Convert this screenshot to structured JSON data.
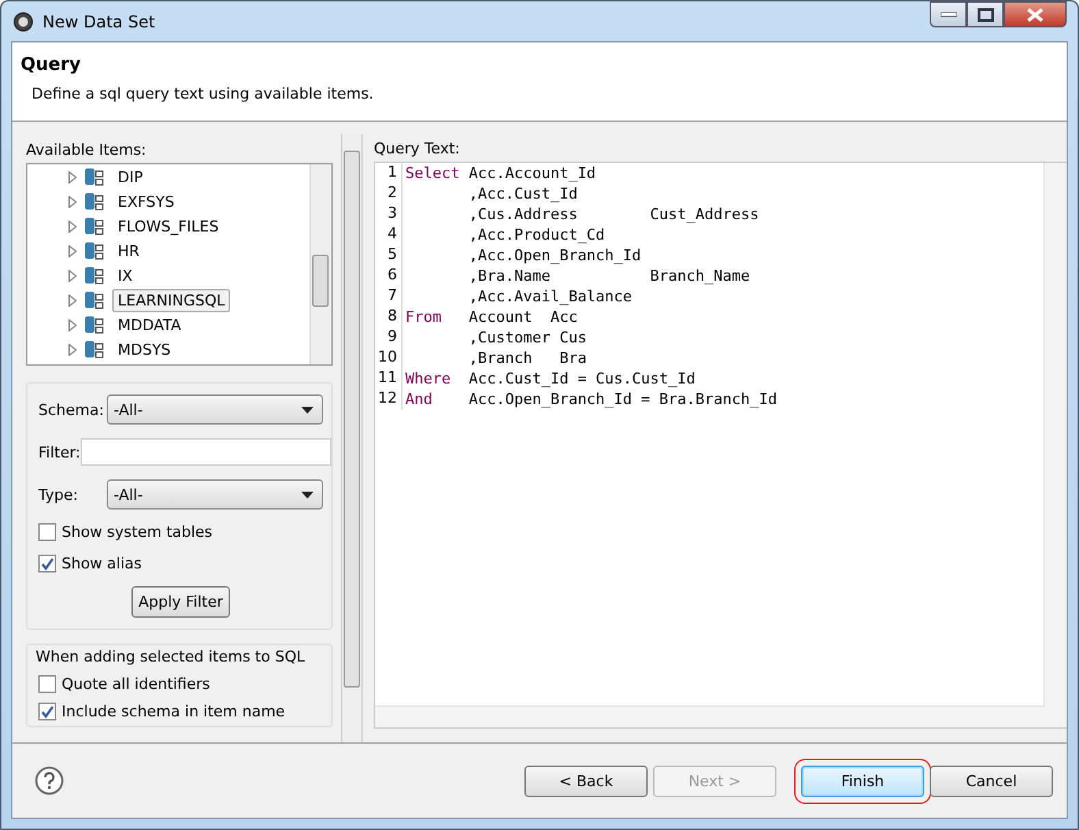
{
  "window": {
    "title": "New Data Set"
  },
  "header": {
    "title": "Query",
    "description": "Define a sql query text using available items."
  },
  "available_items": {
    "label": "Available Items:",
    "items": [
      {
        "label": "DIP",
        "selected": false
      },
      {
        "label": "EXFSYS",
        "selected": false
      },
      {
        "label": "FLOWS_FILES",
        "selected": false
      },
      {
        "label": "HR",
        "selected": false
      },
      {
        "label": "IX",
        "selected": false
      },
      {
        "label": "LEARNINGSQL",
        "selected": true
      },
      {
        "label": "MDDATA",
        "selected": false
      },
      {
        "label": "MDSYS",
        "selected": false
      }
    ]
  },
  "filter": {
    "schema_label": "Schema:",
    "schema_value": "-All-",
    "filter_label": "Filter:",
    "type_label": "Type:",
    "type_value": "-All-",
    "checkboxes": [
      {
        "label": "Show system tables",
        "checked": false
      },
      {
        "label": "Show alias",
        "checked": true
      }
    ],
    "apply_button": "Apply Filter"
  },
  "adding": {
    "title": "When adding selected items to SQL",
    "checkboxes": [
      {
        "label": "Quote all identifiers",
        "checked": false
      },
      {
        "label": "Include schema in item name",
        "checked": true
      }
    ]
  },
  "query": {
    "label": "Query Text:",
    "lines": [
      {
        "number": "1",
        "keyword": "Select",
        "code": "Acc.Account_Id"
      },
      {
        "number": "2",
        "code": ",Acc.Cust_Id"
      },
      {
        "number": "3",
        "code": ",Cus.Address        Cust_Address"
      },
      {
        "number": "4",
        "code": ",Acc.Product_Cd"
      },
      {
        "number": "5",
        "code": ",Acc.Open_Branch_Id"
      },
      {
        "number": "6",
        "code": ",Bra.Name           Branch_Name"
      },
      {
        "number": "7",
        "code": ",Acc.Avail_Balance"
      },
      {
        "number": "8",
        "keyword": "From",
        "code": "Account  Acc"
      },
      {
        "number": "9",
        "code": ",Customer Cus"
      },
      {
        "number": "10",
        "code": ",Branch   Bra"
      },
      {
        "number": "11",
        "keyword": "Where",
        "code": "Acc.Cust_Id = Cus.Cust_Id"
      },
      {
        "number": "12",
        "keyword": "And",
        "code": "Acc.Open_Branch_Id = Bra.Branch_Id"
      }
    ]
  },
  "buttons": [
    {
      "label": "< Back",
      "disabled": false,
      "default": false
    },
    {
      "label": "Next >",
      "disabled": true,
      "default": false
    },
    {
      "label": "Finish",
      "disabled": false,
      "default": true
    },
    {
      "label": "Cancel",
      "disabled": false,
      "default": false
    }
  ]
}
